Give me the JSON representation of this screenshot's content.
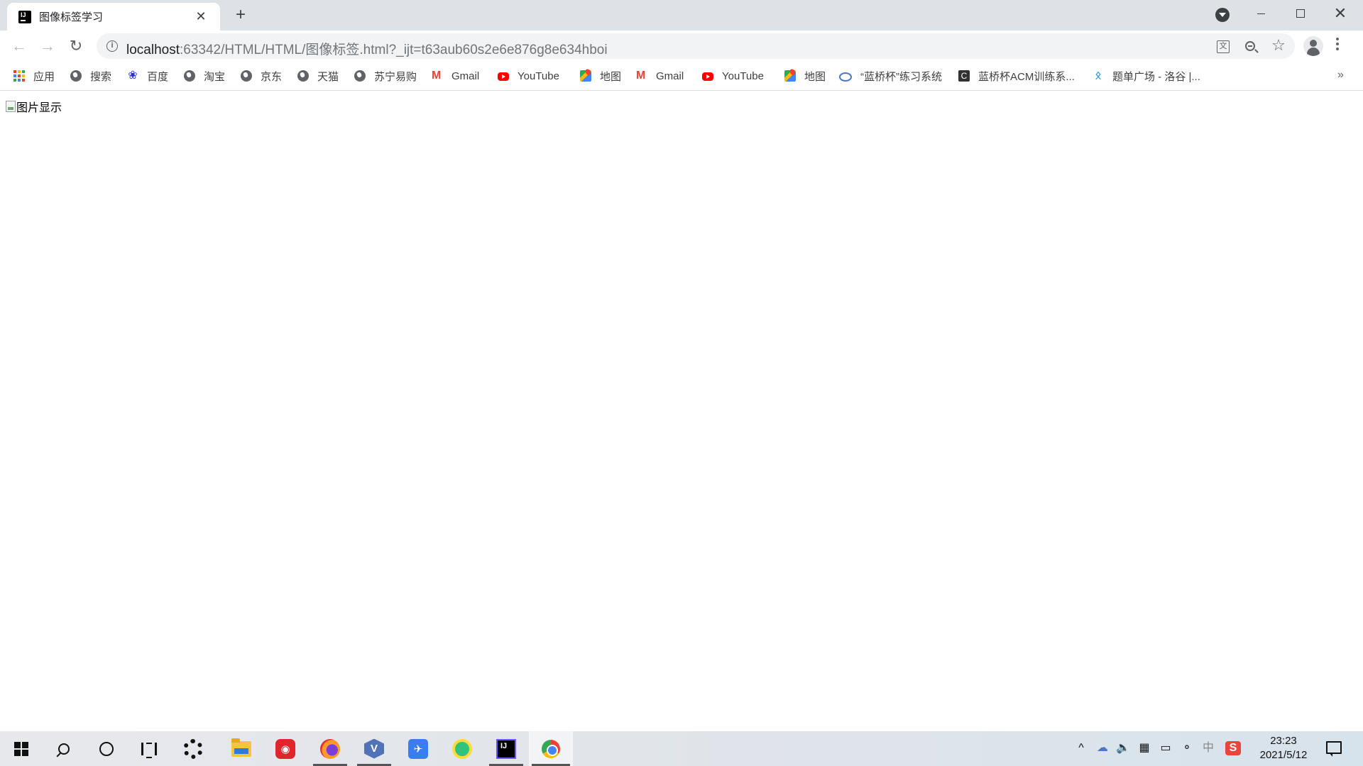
{
  "browser": {
    "tab": {
      "title": "图像标签学习",
      "close_glyph": "✕",
      "favicon": "intellij-idea-icon"
    },
    "new_tab_glyph": "+",
    "window_controls": {
      "minimize": "minimize-icon",
      "maximize": "maximize-icon",
      "close_glyph": "✕"
    },
    "nav": {
      "back_glyph": "←",
      "forward_glyph": "→",
      "reload_glyph": "↻"
    },
    "address_bar": {
      "host": "localhost",
      "rest": ":63342/HTML/HTML/图像标签.html?_ijt=t63aub60s2e6e876g8e634hboi"
    },
    "omnibox_icons": [
      "translate-icon",
      "zoom-icon",
      "star-icon"
    ],
    "translate_glyph": "文",
    "star_glyph": "☆"
  },
  "bookmarks": {
    "items": [
      {
        "label": "应用",
        "icon": "apps-icon"
      },
      {
        "label": "搜索",
        "icon": "globe-icon"
      },
      {
        "label": "百度",
        "icon": "baidu-icon"
      },
      {
        "label": "淘宝",
        "icon": "globe-icon"
      },
      {
        "label": "京东",
        "icon": "globe-icon"
      },
      {
        "label": "天猫",
        "icon": "globe-icon"
      },
      {
        "label": "苏宁易购",
        "icon": "globe-icon"
      },
      {
        "label": "Gmail",
        "icon": "gmail-icon"
      },
      {
        "label": "YouTube",
        "icon": "youtube-icon"
      },
      {
        "label": "地图",
        "icon": "maps-icon"
      },
      {
        "label": "Gmail",
        "icon": "gmail-icon"
      },
      {
        "label": "YouTube",
        "icon": "youtube-icon"
      },
      {
        "label": "地图",
        "icon": "maps-icon"
      },
      {
        "label": "“蓝桥杯”练习系统",
        "icon": "lanqiao-icon"
      },
      {
        "label": "蓝桥杯ACM训练系...",
        "icon": "c-icon"
      },
      {
        "label": "题单广场 - 洛谷 |...",
        "icon": "luogu-icon"
      }
    ],
    "more_glyph": "»",
    "baidu_glyph": "❀",
    "c_glyph": "C",
    "luogu_glyph": "ᛟ"
  },
  "page": {
    "image_alt": "图片显示"
  },
  "taskbar": {
    "apps": [
      "start-icon",
      "search-icon",
      "cortana-icon",
      "task-view-icon",
      "pinwheel-app-icon",
      "file-explorer-icon",
      "netease-music-icon",
      "firefox-icon",
      "visual-studio-icon",
      "feishu-icon",
      "qq-music-icon",
      "intellij-idea-icon",
      "chrome-icon"
    ],
    "netease_glyph": "◉",
    "feishu_glyph": "✈",
    "vs_glyph": "V",
    "tray": {
      "chevron": "^",
      "cloud": "☁",
      "volume": "🔈",
      "network_glyph": "⚬",
      "ime": "中",
      "sogou": "S"
    },
    "clock": {
      "time": "23:23",
      "date": "2021/5/12"
    }
  }
}
